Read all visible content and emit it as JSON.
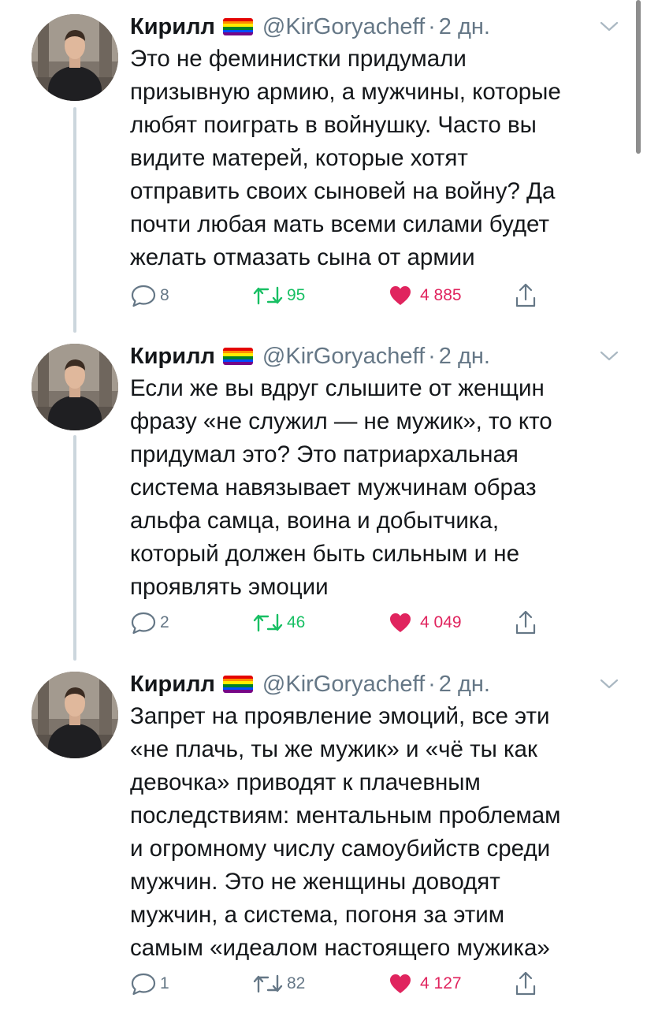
{
  "colors": {
    "text": "#14171a",
    "secondary": "#657786",
    "retweet": "#17bf63",
    "like": "#e0245e",
    "thread_line": "#ccd6dd"
  },
  "flag_colors": [
    "#e40303",
    "#ff8c00",
    "#ffed00",
    "#008026",
    "#004dff",
    "#750787"
  ],
  "tweets": [
    {
      "name": "Кирилл",
      "handle": "@KirGoryacheff",
      "separator": "·",
      "time": "2 дн.",
      "lines": [
        "Это не феминистки придумали",
        "призывную армию, а мужчины, которые",
        "любят поиграть в войнушку. Часто вы",
        "видите матерей, которые хотят",
        "отправить своих сыновей на войну? Да",
        "почти любая мать всеми силами будет",
        "желать отмазать сына от армии"
      ],
      "replies": "8",
      "retweets": "95",
      "likes": "4 885",
      "icons": [
        "reply-icon",
        "retweet-icon",
        "heart-icon",
        "share-icon"
      ]
    },
    {
      "name": "Кирилл",
      "handle": "@KirGoryacheff",
      "separator": "·",
      "time": "2 дн.",
      "lines": [
        "Если же вы вдруг слышите от женщин",
        "фразу «не служил — не мужик», то кто",
        "придумал это? Это патриархальная",
        "система навязывает мужчинам образ",
        "альфа самца, воина и добытчика,",
        "который должен быть сильным и не",
        "проявлять эмоции"
      ],
      "replies": "2",
      "retweets": "46",
      "likes": "4 049",
      "icons": [
        "reply-icon",
        "retweet-icon",
        "heart-icon",
        "share-icon"
      ]
    },
    {
      "name": "Кирилл",
      "handle": "@KirGoryacheff",
      "separator": "·",
      "time": "2 дн.",
      "lines": [
        "Запрет на проявление эмоций, все эти",
        "«не плачь, ты же мужик» и «чё ты как",
        "девочка» приводят к плачевным",
        "последствиям: ментальным проблемам",
        "и огромному числу самоубийств среди",
        "мужчин. Это не женщины доводят",
        "мужчин, а система, погоня за этим",
        "самым «идеалом настоящего мужика»"
      ],
      "replies": "1",
      "retweets": "82",
      "likes": "4 127",
      "icons": [
        "reply-icon",
        "retweet-icon",
        "heart-icon",
        "share-icon"
      ]
    }
  ]
}
